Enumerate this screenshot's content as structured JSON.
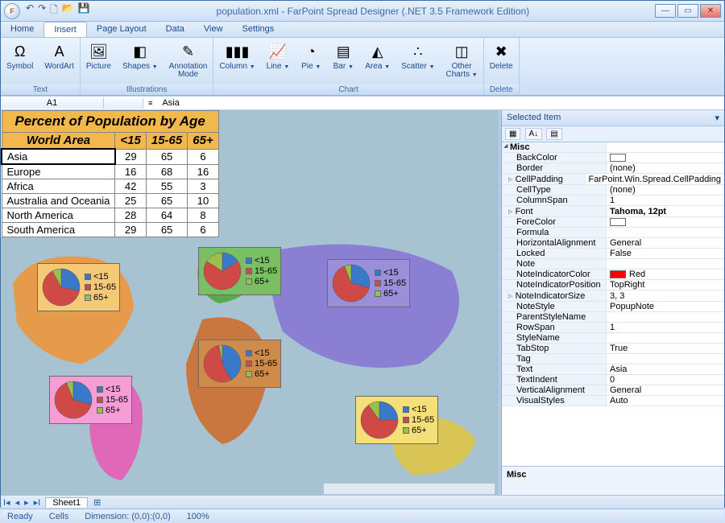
{
  "window": {
    "title": "population.xml - FarPoint Spread Designer (.NET 3.5 Framework Edition)"
  },
  "qat": [
    "↶",
    "↷",
    "🗋",
    "📂",
    "💾"
  ],
  "menu": [
    "Home",
    "Insert",
    "Page Layout",
    "Data",
    "View",
    "Settings"
  ],
  "activeMenu": "Insert",
  "ribbon": {
    "groups": [
      {
        "label": "Text",
        "items": [
          {
            "icon": "Ω",
            "label": "Symbol"
          },
          {
            "icon": "A",
            "label": "WordArt"
          }
        ]
      },
      {
        "label": "Illustrations",
        "items": [
          {
            "icon": "🖼",
            "label": "Picture"
          },
          {
            "icon": "◧",
            "label": "Shapes",
            "dd": true
          },
          {
            "icon": "✎",
            "label": "Annotation\nMode"
          }
        ]
      },
      {
        "label": "Chart",
        "items": [
          {
            "icon": "▮▮▮",
            "label": "Column",
            "dd": true
          },
          {
            "icon": "📈",
            "label": "Line",
            "dd": true
          },
          {
            "icon": "◔",
            "label": "Pie",
            "dd": true
          },
          {
            "icon": "▤",
            "label": "Bar",
            "dd": true
          },
          {
            "icon": "◭",
            "label": "Area",
            "dd": true
          },
          {
            "icon": "∴",
            "label": "Scatter",
            "dd": true
          },
          {
            "icon": "◫",
            "label": "Other\nCharts",
            "dd": true
          }
        ]
      },
      {
        "label": "Delete",
        "items": [
          {
            "icon": "✖",
            "label": "Delete"
          }
        ]
      }
    ]
  },
  "namebox": "A1",
  "formula_value": "Asia",
  "table": {
    "title": "Percent of Population by Age",
    "headers": [
      "World Area",
      "<15",
      "15-65",
      "65+"
    ],
    "rows": [
      [
        "Asia",
        29,
        65,
        6
      ],
      [
        "Europe",
        16,
        68,
        16
      ],
      [
        "Africa",
        42,
        55,
        3
      ],
      [
        "Australia and Oceania",
        25,
        65,
        10
      ],
      [
        "North America",
        28,
        64,
        8
      ],
      [
        "South America",
        29,
        65,
        6
      ]
    ]
  },
  "chart_data": {
    "type": "pie",
    "legend_labels": [
      "<15",
      "15-65",
      "65+"
    ],
    "colors": {
      "<15": "#3a78c9",
      "15-65": "#cf4a46",
      "65+": "#9bbf4d"
    },
    "series": [
      {
        "name": "North America",
        "values": [
          28,
          64,
          8
        ],
        "card_bg": "#f4c978"
      },
      {
        "name": "South America",
        "values": [
          29,
          65,
          6
        ],
        "card_bg": "#f49dd6"
      },
      {
        "name": "Europe",
        "values": [
          16,
          68,
          16
        ],
        "card_bg": "#7abf63"
      },
      {
        "name": "Africa",
        "values": [
          42,
          55,
          3
        ],
        "card_bg": "#d08a4a"
      },
      {
        "name": "Asia",
        "values": [
          29,
          65,
          6
        ],
        "card_bg": "#9a8fd8"
      },
      {
        "name": "Australia and Oceania",
        "values": [
          25,
          65,
          10
        ],
        "card_bg": "#f4df78"
      }
    ]
  },
  "props": {
    "header": "Selected Item",
    "category": "Misc",
    "rows": [
      {
        "n": "BackColor",
        "v": "",
        "swatch": "#ffffff"
      },
      {
        "n": "Border",
        "v": "(none)"
      },
      {
        "n": "CellPadding",
        "v": "FarPoint.Win.Spread.CellPadding",
        "exp": true
      },
      {
        "n": "CellType",
        "v": "(none)"
      },
      {
        "n": "ColumnSpan",
        "v": "1"
      },
      {
        "n": "Font",
        "v": "Tahoma, 12pt",
        "bold": true,
        "exp": true
      },
      {
        "n": "ForeColor",
        "v": "",
        "swatch": "#ffffff"
      },
      {
        "n": "Formula",
        "v": ""
      },
      {
        "n": "HorizontalAlignment",
        "v": "General"
      },
      {
        "n": "Locked",
        "v": "False"
      },
      {
        "n": "Note",
        "v": ""
      },
      {
        "n": "NoteIndicatorColor",
        "v": "Red",
        "swatch": "#ff0000"
      },
      {
        "n": "NoteIndicatorPosition",
        "v": "TopRight"
      },
      {
        "n": "NoteIndicatorSize",
        "v": "3, 3",
        "exp": true
      },
      {
        "n": "NoteStyle",
        "v": "PopupNote"
      },
      {
        "n": "ParentStyleName",
        "v": ""
      },
      {
        "n": "RowSpan",
        "v": "1"
      },
      {
        "n": "StyleName",
        "v": ""
      },
      {
        "n": "TabStop",
        "v": "True"
      },
      {
        "n": "Tag",
        "v": ""
      },
      {
        "n": "Text",
        "v": "Asia"
      },
      {
        "n": "TextIndent",
        "v": "0"
      },
      {
        "n": "VerticalAlignment",
        "v": "General"
      },
      {
        "n": "VisualStyles",
        "v": "Auto"
      }
    ],
    "desc": "Misc"
  },
  "sheetTab": "Sheet1",
  "status": {
    "ready": "Ready",
    "cells": "Cells",
    "dim": "Dimension: (0,0):(0,0)",
    "zoom": "100%"
  }
}
